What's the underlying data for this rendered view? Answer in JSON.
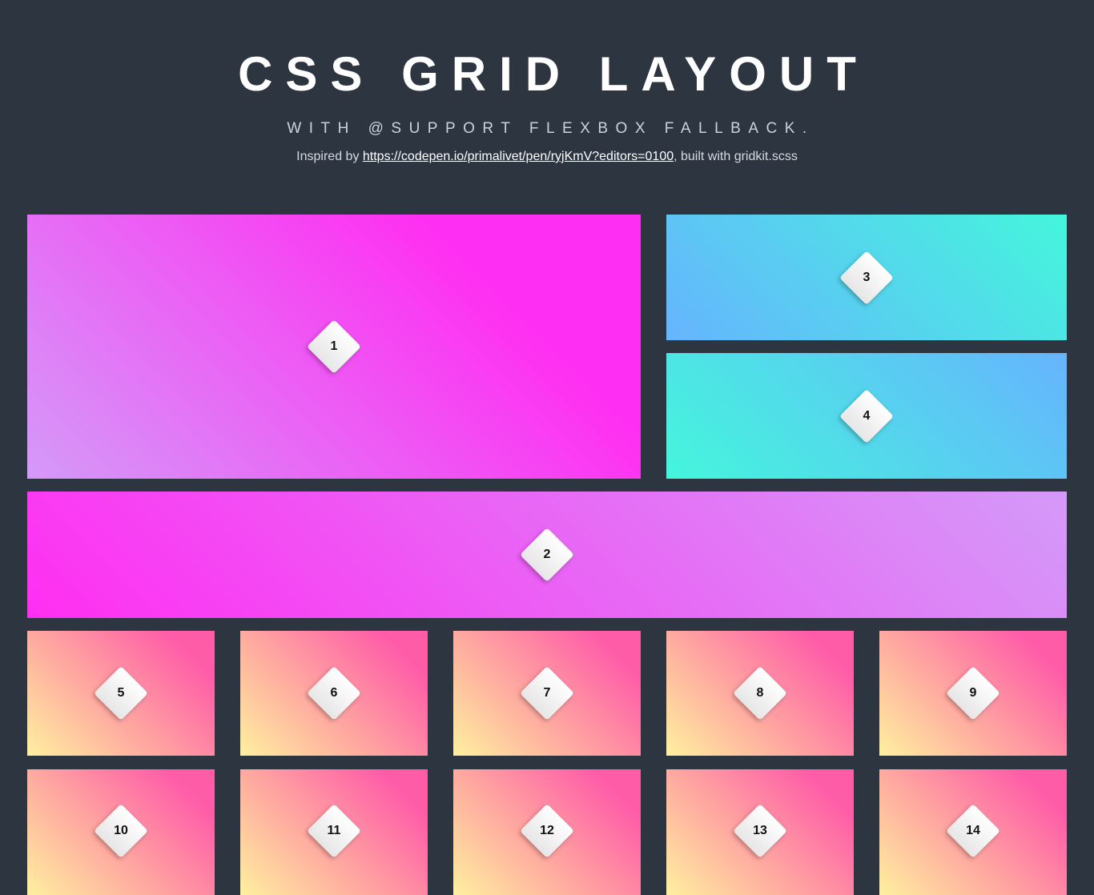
{
  "header": {
    "title": "CSS GRID LAYOUT",
    "subtitle": "WITH @SUPPORT FLEXBOX FALLBACK.",
    "credit_prefix": "Inspired by ",
    "credit_link": "https://codepen.io/primalivet/pen/ryjKmV?editors=0100",
    "credit_suffix": ", built with gridkit.scss"
  },
  "tiles": [
    {
      "label": "1",
      "color": "#ff2ef2"
    },
    {
      "label": "2",
      "color": "#ff2ef2"
    },
    {
      "label": "3",
      "color": "#44f6dc"
    },
    {
      "label": "4",
      "color": "#66b4fd"
    },
    {
      "label": "5",
      "color": "#ff5ca8"
    },
    {
      "label": "6",
      "color": "#ff5ca8"
    },
    {
      "label": "7",
      "color": "#ff5ca8"
    },
    {
      "label": "8",
      "color": "#ff5ca8"
    },
    {
      "label": "9",
      "color": "#ff5ca8"
    },
    {
      "label": "10",
      "color": "#ff5ca8"
    },
    {
      "label": "11",
      "color": "#ff5ca8"
    },
    {
      "label": "12",
      "color": "#ff5ca8"
    },
    {
      "label": "13",
      "color": "#ff5ca8"
    },
    {
      "label": "14",
      "color": "#ff5ca8"
    }
  ]
}
